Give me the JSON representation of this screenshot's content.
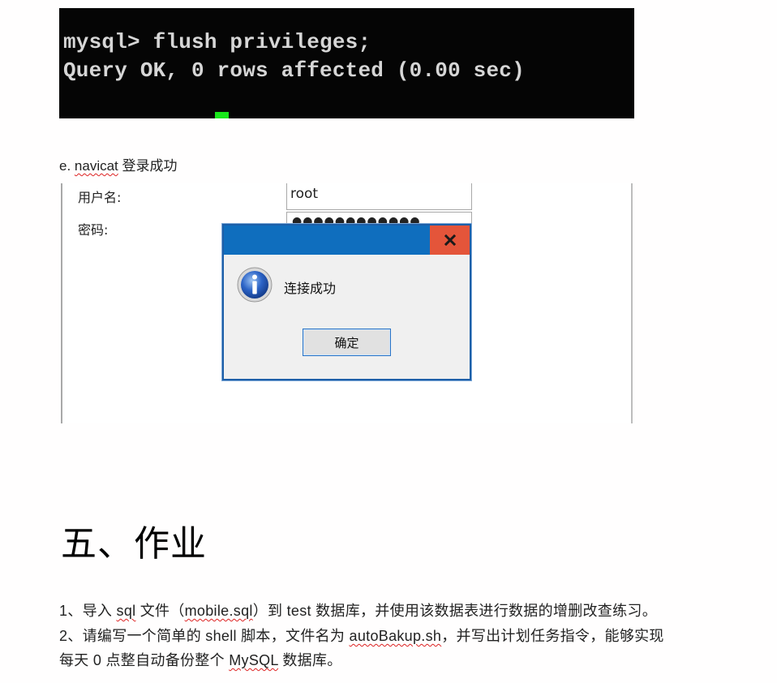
{
  "terminal": {
    "line1": "mysql> flush privileges;",
    "line2": "Query OK, 0 rows affected (0.00 sec)"
  },
  "caption": {
    "prefix": "e. ",
    "app": "navicat",
    "suffix": " 登录成功"
  },
  "login_form": {
    "username_label": "用户名:",
    "username_value": "root",
    "password_label": "密码:",
    "password_mask": "●●●●●●●●●●●●"
  },
  "dialog": {
    "message": "连接成功",
    "ok_label": "确定",
    "close_label": "x"
  },
  "section": {
    "heading": "五、作业"
  },
  "assignment": {
    "item1": {
      "a": "1、导入 ",
      "b": "sql",
      "c": " 文件（",
      "d": "mobile.sql",
      "e": "）到 test 数据库，并使用该数据表进行数据的增删改查练习。"
    },
    "item2_line1": {
      "a": "2、请编写一个简单的 shell 脚本，文件名为 ",
      "b": "autoBakup.sh",
      "c": "，并写出计划任务指令，能够实现"
    },
    "item2_line2": {
      "a": "每天 0 点整自动备份整个 ",
      "b": "MySQL",
      "c": " 数据库。"
    }
  },
  "colors": {
    "terminal_bg": "#050505",
    "cursor": "#19e61b",
    "titlebar": "#0f6ebe",
    "close": "#e4553a"
  }
}
